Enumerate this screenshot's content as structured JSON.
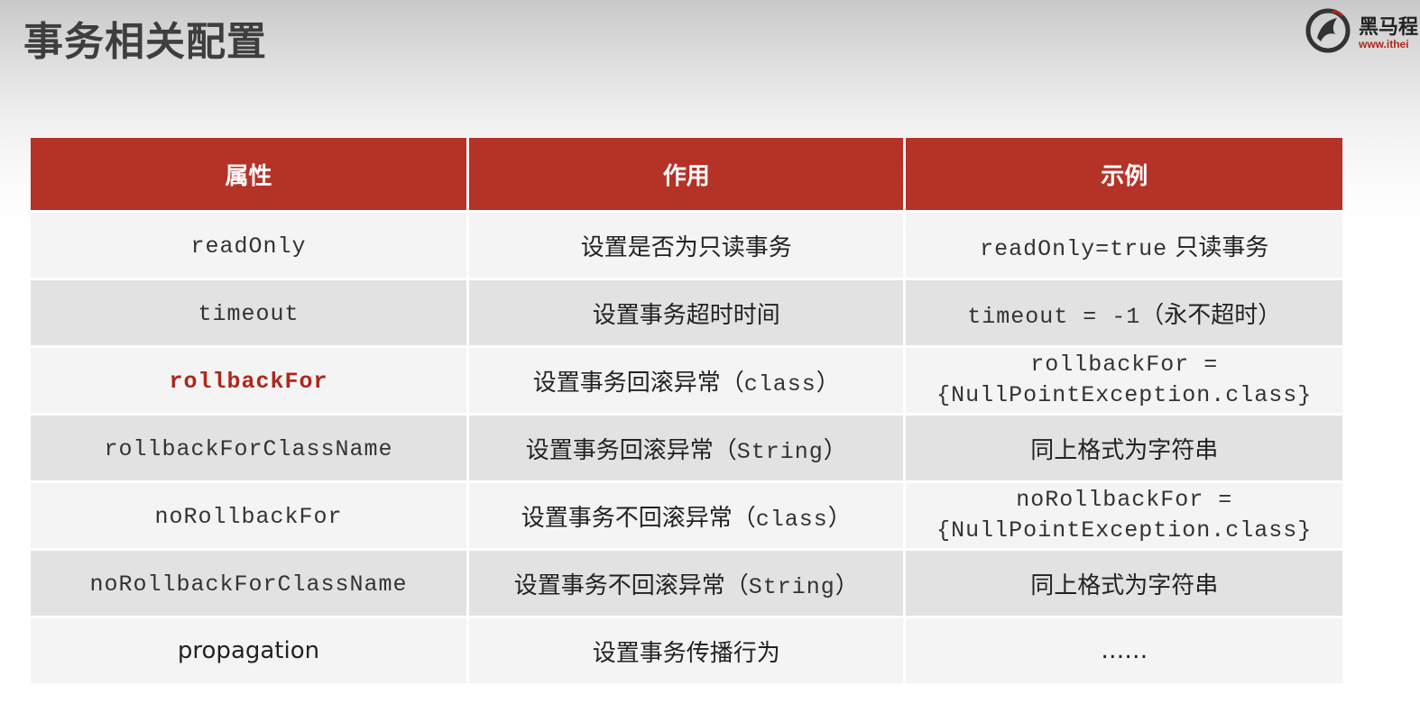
{
  "slide": {
    "title": "事务相关配置"
  },
  "logo": {
    "text": "黑马程",
    "url": "www.ithei"
  },
  "table": {
    "headers": [
      "属性",
      "作用",
      "示例"
    ],
    "rows": [
      {
        "attribute": "readOnly",
        "purpose": "设置是否为只读事务",
        "example_code": "readOnly=true",
        "example_text": " 只读事务"
      },
      {
        "attribute": "timeout",
        "purpose": "设置事务超时时间",
        "example_code": "timeout = -1",
        "example_text": "（永不超时）"
      },
      {
        "attribute": "rollbackFor",
        "purpose_text": "设置事务回滚异常（",
        "purpose_code": "class",
        "purpose_end": "）",
        "example_line1": "rollbackFor =",
        "example_line2": "{NullPointException.class}"
      },
      {
        "attribute": "rollbackForClassName",
        "purpose_text": "设置事务回滚异常（",
        "purpose_code": "String",
        "purpose_end": "）",
        "example": "同上格式为字符串"
      },
      {
        "attribute": "noRollbackFor",
        "purpose_text": "设置事务不回滚异常（",
        "purpose_code": "class",
        "purpose_end": "）",
        "example_line1": "noRollbackFor =",
        "example_line2": "{NullPointException.class}"
      },
      {
        "attribute": "noRollbackForClassName",
        "purpose_text": "设置事务不回滚异常（",
        "purpose_code": "String",
        "purpose_end": "）",
        "example": "同上格式为字符串"
      },
      {
        "attribute": "propagation",
        "purpose": "设置事务传播行为",
        "example": "……"
      }
    ]
  },
  "colors": {
    "header_bg": "#b53227",
    "highlight_text": "#b0261c",
    "row_light": "#f4f4f4",
    "row_dark": "#e2e2e2"
  }
}
